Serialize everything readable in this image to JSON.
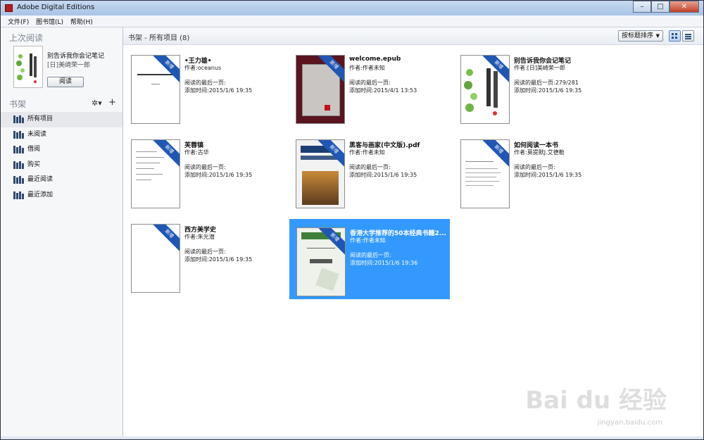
{
  "window": {
    "title": "Adobe Digital Editions",
    "controls": {
      "minimize": "–",
      "maximize": "□",
      "close": "✕"
    }
  },
  "menu": [
    {
      "label": "文件(F)"
    },
    {
      "label": "图书馆(L)"
    },
    {
      "label": "帮助(H)"
    }
  ],
  "sidebar": {
    "last_read_heading": "上次阅读",
    "last_read": {
      "title": "别告诉我你会记笔记",
      "author": "[日]美崎荣一郎",
      "read_button": "阅读"
    },
    "bookshelf_heading": "书架",
    "shelves": [
      {
        "label": "所有项目",
        "selected": true
      },
      {
        "label": "未阅读",
        "selected": false
      },
      {
        "label": "借阅",
        "selected": false
      },
      {
        "label": "购买",
        "selected": false
      },
      {
        "label": "最近阅读",
        "selected": false
      },
      {
        "label": "最近添加",
        "selected": false
      }
    ]
  },
  "main": {
    "header_title": "书架 - 所有项目 (8)",
    "sort_label": "按标题排序",
    "books": [
      {
        "title": "•王力雄•",
        "author": "作者:oceanus",
        "last_page": "阅读的最后一页:",
        "added": "添加时间:2015/1/6 19:35",
        "badge": "新增",
        "selected": false,
        "cover_style": "plain"
      },
      {
        "title": "welcome.epub",
        "author": "作者:作者未知",
        "last_page": "阅读的最后一页:",
        "added": "添加时间:2015/4/1 13:53",
        "badge": "新增",
        "selected": false,
        "cover_style": "dark-red"
      },
      {
        "title": "别告诉我你会记笔记",
        "author": "作者:[日]美崎荣一郎",
        "last_page": "阅读的最后一页:279/281",
        "added": "添加时间:2015/1/6 19:35",
        "badge": "新增",
        "selected": false,
        "cover_style": "notes"
      },
      {
        "title": "芙蓉镇",
        "author": "作者:古华",
        "last_page": "阅读的最后一页:",
        "added": "添加时间:2015/1/6 19:35",
        "badge": "新增",
        "selected": false,
        "cover_style": "text"
      },
      {
        "title": "黑客与画家(中文版).pdf",
        "author": "作者:作者未知",
        "last_page": "阅读的最后一页:",
        "added": "添加时间:2015/1/6 19:35",
        "badge": "新增",
        "selected": false,
        "cover_style": "hackers"
      },
      {
        "title": "如何阅读一本书",
        "author": "作者:莫提默J.艾德勒",
        "last_page": "阅读的最后一页:",
        "added": "添加时间:2015/1/6 19:35",
        "badge": "新增",
        "selected": false,
        "cover_style": "text"
      },
      {
        "title": "西方美学史",
        "author": "作者:朱光潜",
        "last_page": "阅读的最后一页:",
        "added": "添加时间:2015/1/6 19:35",
        "badge": "新增",
        "selected": false,
        "cover_style": "plain"
      },
      {
        "title": "香港大学推荐的50本经典书籍2...",
        "author": "作者:作者未知",
        "last_page": "阅读的最后一页:",
        "added": "添加时间:2015/1/6 19:36",
        "badge": "新增",
        "selected": true,
        "cover_style": "green"
      }
    ]
  },
  "colors": {
    "selection": "#3399ff",
    "ribbon": "#1f57b5",
    "sidebar_bg": "#f6f7f9"
  }
}
